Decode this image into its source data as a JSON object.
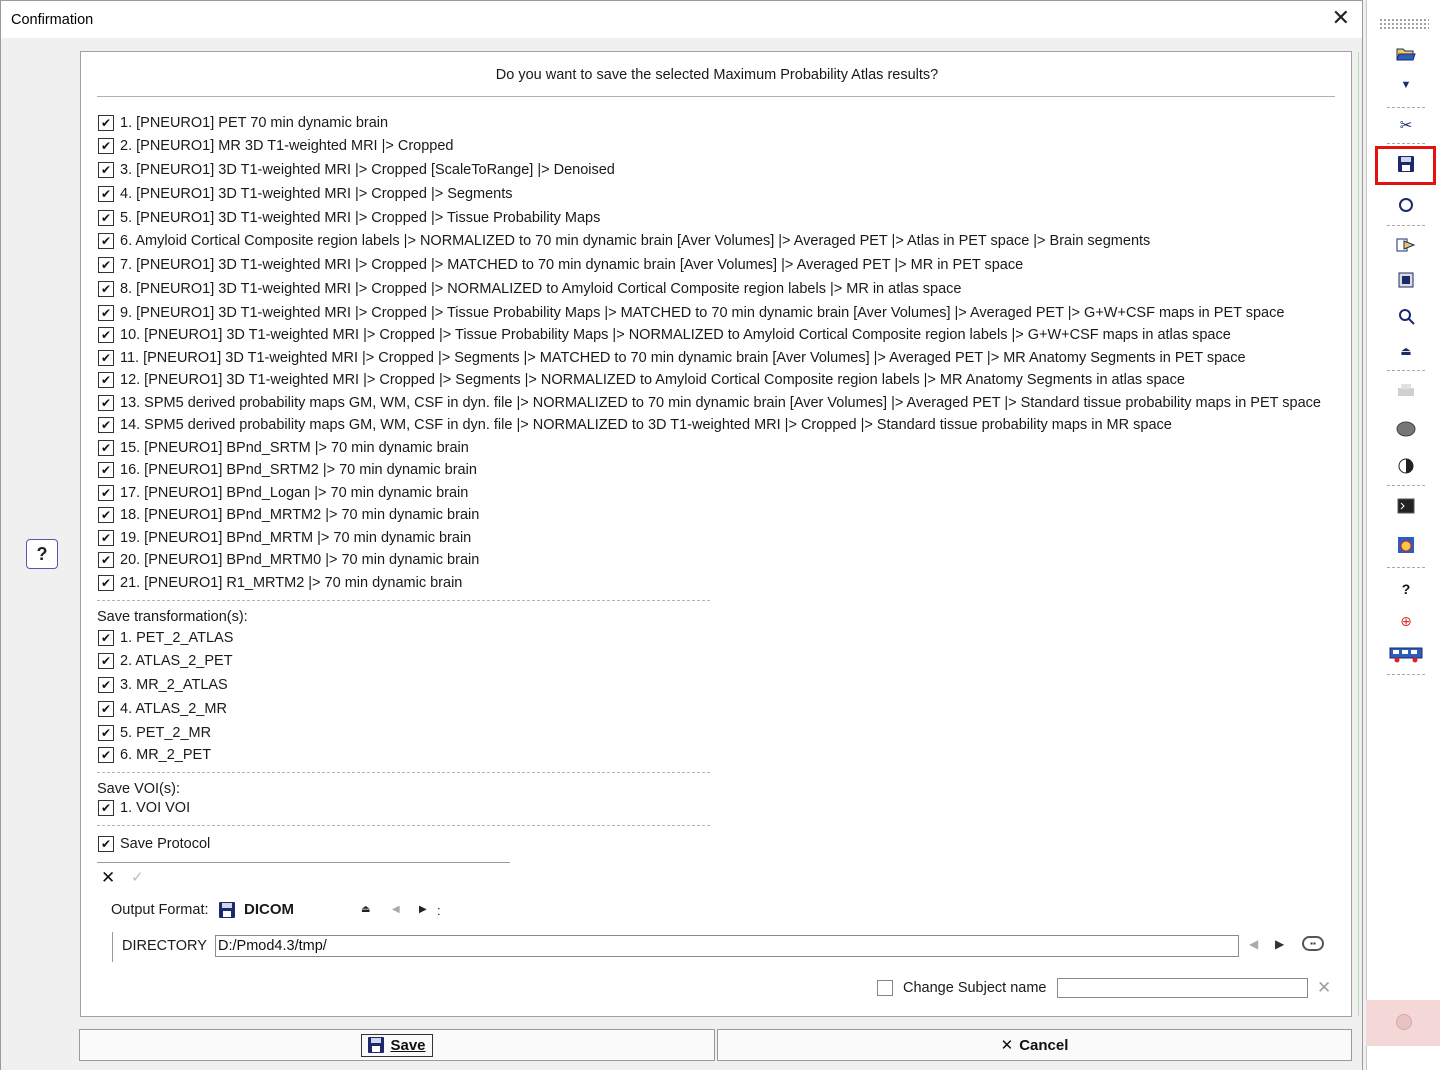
{
  "window": {
    "title": "Confirmation",
    "close_glyph": "✕"
  },
  "help": {
    "label": "?"
  },
  "question": "Do you want to save the selected Maximum Probability Atlas results?",
  "results": [
    {
      "label": "1. [PNEURO1] PET 70 min dynamic brain",
      "checked": true
    },
    {
      "label": "2. [PNEURO1] MR 3D T1-weighted MRI |> Cropped",
      "checked": true
    },
    {
      "label": "3. [PNEURO1] 3D T1-weighted MRI |> Cropped [ScaleToRange] |> Denoised",
      "checked": true
    },
    {
      "label": "4. [PNEURO1] 3D T1-weighted MRI |> Cropped |> Segments",
      "checked": true
    },
    {
      "label": "5. [PNEURO1] 3D T1-weighted MRI |> Cropped |> Tissue Probability Maps",
      "checked": true
    },
    {
      "label": "6. Amyloid Cortical Composite region labels |> NORMALIZED to 70 min dynamic brain [Aver Volumes] |> Averaged PET |> Atlas in PET space |> Brain segments",
      "checked": true
    },
    {
      "label": "7. [PNEURO1] 3D T1-weighted MRI |> Cropped |> MATCHED to 70 min dynamic brain [Aver Volumes] |> Averaged PET |> MR in PET space",
      "checked": true
    },
    {
      "label": "8. [PNEURO1] 3D T1-weighted MRI |> Cropped |> NORMALIZED to Amyloid Cortical Composite region labels |> MR in atlas space",
      "checked": true
    },
    {
      "label": "9. [PNEURO1] 3D T1-weighted MRI |> Cropped |> Tissue Probability Maps |> MATCHED to 70 min dynamic brain [Aver Volumes] |> Averaged PET |> G+W+CSF maps in PET space",
      "checked": true
    },
    {
      "label": "10. [PNEURO1] 3D T1-weighted MRI |> Cropped |> Tissue Probability Maps |> NORMALIZED to Amyloid Cortical Composite region labels |> G+W+CSF maps in atlas space",
      "checked": true
    },
    {
      "label": "11. [PNEURO1] 3D T1-weighted MRI |> Cropped |> Segments |> MATCHED to 70 min dynamic brain [Aver Volumes] |> Averaged PET |> MR Anatomy Segments in PET space",
      "checked": true
    },
    {
      "label": "12. [PNEURO1] 3D T1-weighted MRI |> Cropped |> Segments |> NORMALIZED to Amyloid Cortical Composite region labels |> MR Anatomy Segments in atlas space",
      "checked": true
    },
    {
      "label": "13. SPM5 derived probability maps GM, WM, CSF in dyn. file |> NORMALIZED to 70 min dynamic brain [Aver Volumes] |> Averaged PET |> Standard tissue probability maps in PET space",
      "checked": true
    },
    {
      "label": "14. SPM5 derived probability maps GM, WM, CSF in dyn. file |> NORMALIZED to 3D T1-weighted MRI |> Cropped |> Standard tissue probability maps in MR space",
      "checked": true
    },
    {
      "label": "15. [PNEURO1] BPnd_SRTM |> 70 min dynamic brain",
      "checked": true
    },
    {
      "label": "16. [PNEURO1] BPnd_SRTM2 |> 70 min dynamic brain",
      "checked": true
    },
    {
      "label": "17. [PNEURO1] BPnd_Logan |> 70 min dynamic brain",
      "checked": true
    },
    {
      "label": "18. [PNEURO1] BPnd_MRTM2 |> 70 min dynamic brain",
      "checked": true
    },
    {
      "label": "19. [PNEURO1] BPnd_MRTM |> 70 min dynamic brain",
      "checked": true
    },
    {
      "label": "20. [PNEURO1] BPnd_MRTM0 |> 70 min dynamic brain",
      "checked": true
    },
    {
      "label": "21. [PNEURO1] R1_MRTM2 |> 70 min dynamic brain",
      "checked": true
    }
  ],
  "transformations": {
    "label": "Save transformation(s):",
    "items": [
      {
        "label": "1. PET_2_ATLAS",
        "checked": true
      },
      {
        "label": "2. ATLAS_2_PET",
        "checked": true
      },
      {
        "label": "3. MR_2_ATLAS",
        "checked": true
      },
      {
        "label": "4. ATLAS_2_MR",
        "checked": true
      },
      {
        "label": "5. PET_2_MR",
        "checked": true
      },
      {
        "label": "6. MR_2_PET",
        "checked": true
      }
    ]
  },
  "vois": {
    "label": "Save VOI(s):",
    "items": [
      {
        "label": "1. VOI VOI",
        "checked": true
      }
    ]
  },
  "protocol": {
    "label": "Save Protocol",
    "checked": true
  },
  "checkmark_glyph": "✔",
  "output": {
    "format_label": "Output Format:",
    "format_value": "DICOM",
    "format_icon": "floppy-disk-icon",
    "colon": ":",
    "directory_label": "DIRECTORY",
    "directory_value": "D:/Pmod4.3/tmp/"
  },
  "change_subject": {
    "label": "Change Subject name",
    "checked": false,
    "value": ""
  },
  "buttons": {
    "save_label": "Save",
    "cancel_label": "Cancel"
  },
  "colors": {
    "highlight": "#e51010",
    "icon_blue": "#1c2a6b",
    "panel_bg": "#ffffff",
    "dialog_bg": "#f0f0f0"
  }
}
